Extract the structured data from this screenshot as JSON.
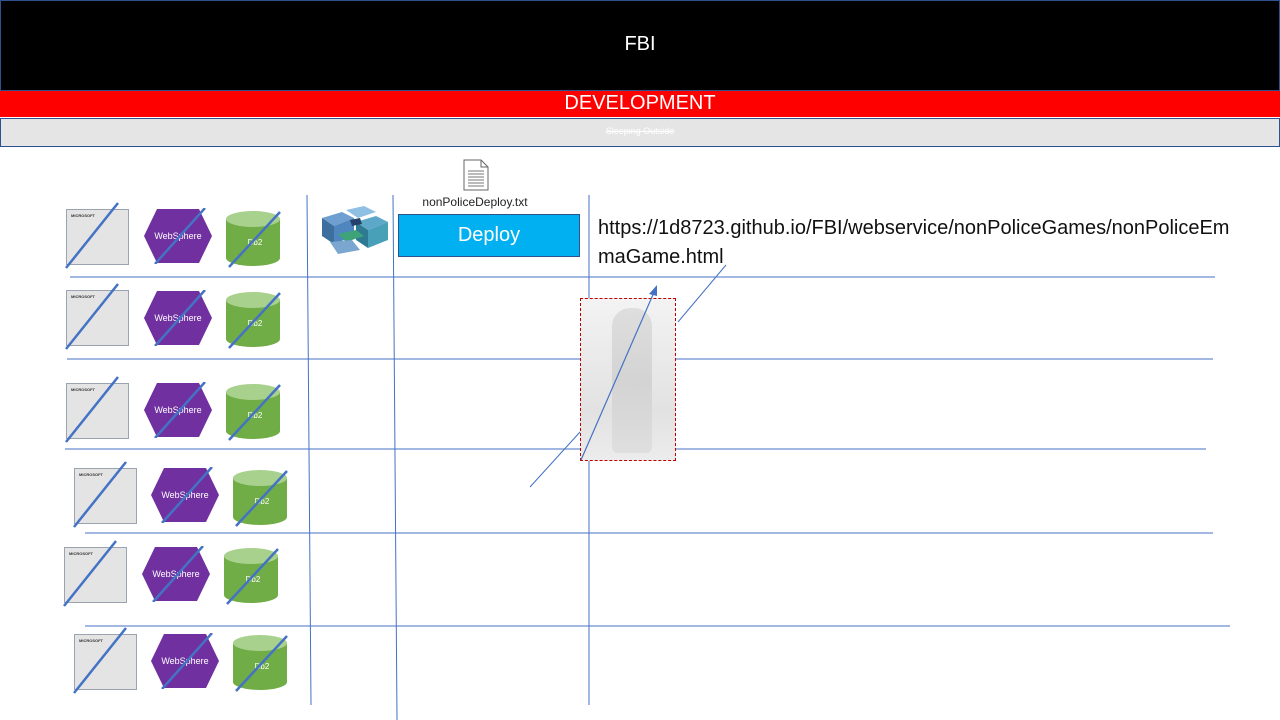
{
  "header": {
    "title": "FBI",
    "bg_color": "#000000"
  },
  "environment_bar": {
    "title": "DEVELOPMENT",
    "bg_color": "#ff0000"
  },
  "sub_bar": {
    "text": "Sleeping Outside"
  },
  "deploy": {
    "file_name": "nonPoliceDeploy.txt",
    "button_label": "Deploy",
    "button_color": "#00b0f0"
  },
  "url": {
    "text": "https://1d8723.github.io/FBI/webservice/nonPoliceGames/nonPoliceEmmaGame.html"
  },
  "stack_rows": [
    {
      "microsoft": "MICROSOFT",
      "websphere": "WebSphere",
      "db2": "Db2"
    },
    {
      "microsoft": "MICROSOFT",
      "websphere": "WebSphere",
      "db2": "Db2"
    },
    {
      "microsoft": "MICROSOFT",
      "websphere": "WebSphere",
      "db2": "Db2"
    },
    {
      "microsoft": "MICROSOFT",
      "websphere": "WebSphere",
      "db2": "Db2"
    },
    {
      "microsoft": "MICROSOFT",
      "websphere": "WebSphere",
      "db2": "Db2"
    },
    {
      "microsoft": "MICROSOFT",
      "websphere": "WebSphere",
      "db2": "Db2"
    }
  ],
  "colors": {
    "line": "#4472c4",
    "websphere": "#7030a0",
    "db2": "#70ad47",
    "db2_top": "#a9d18e"
  },
  "icons": [
    "document-icon",
    "tools-cluster-icon",
    "microsoft-logo-icon",
    "websphere-icon",
    "db2-database-icon",
    "photo-image"
  ]
}
